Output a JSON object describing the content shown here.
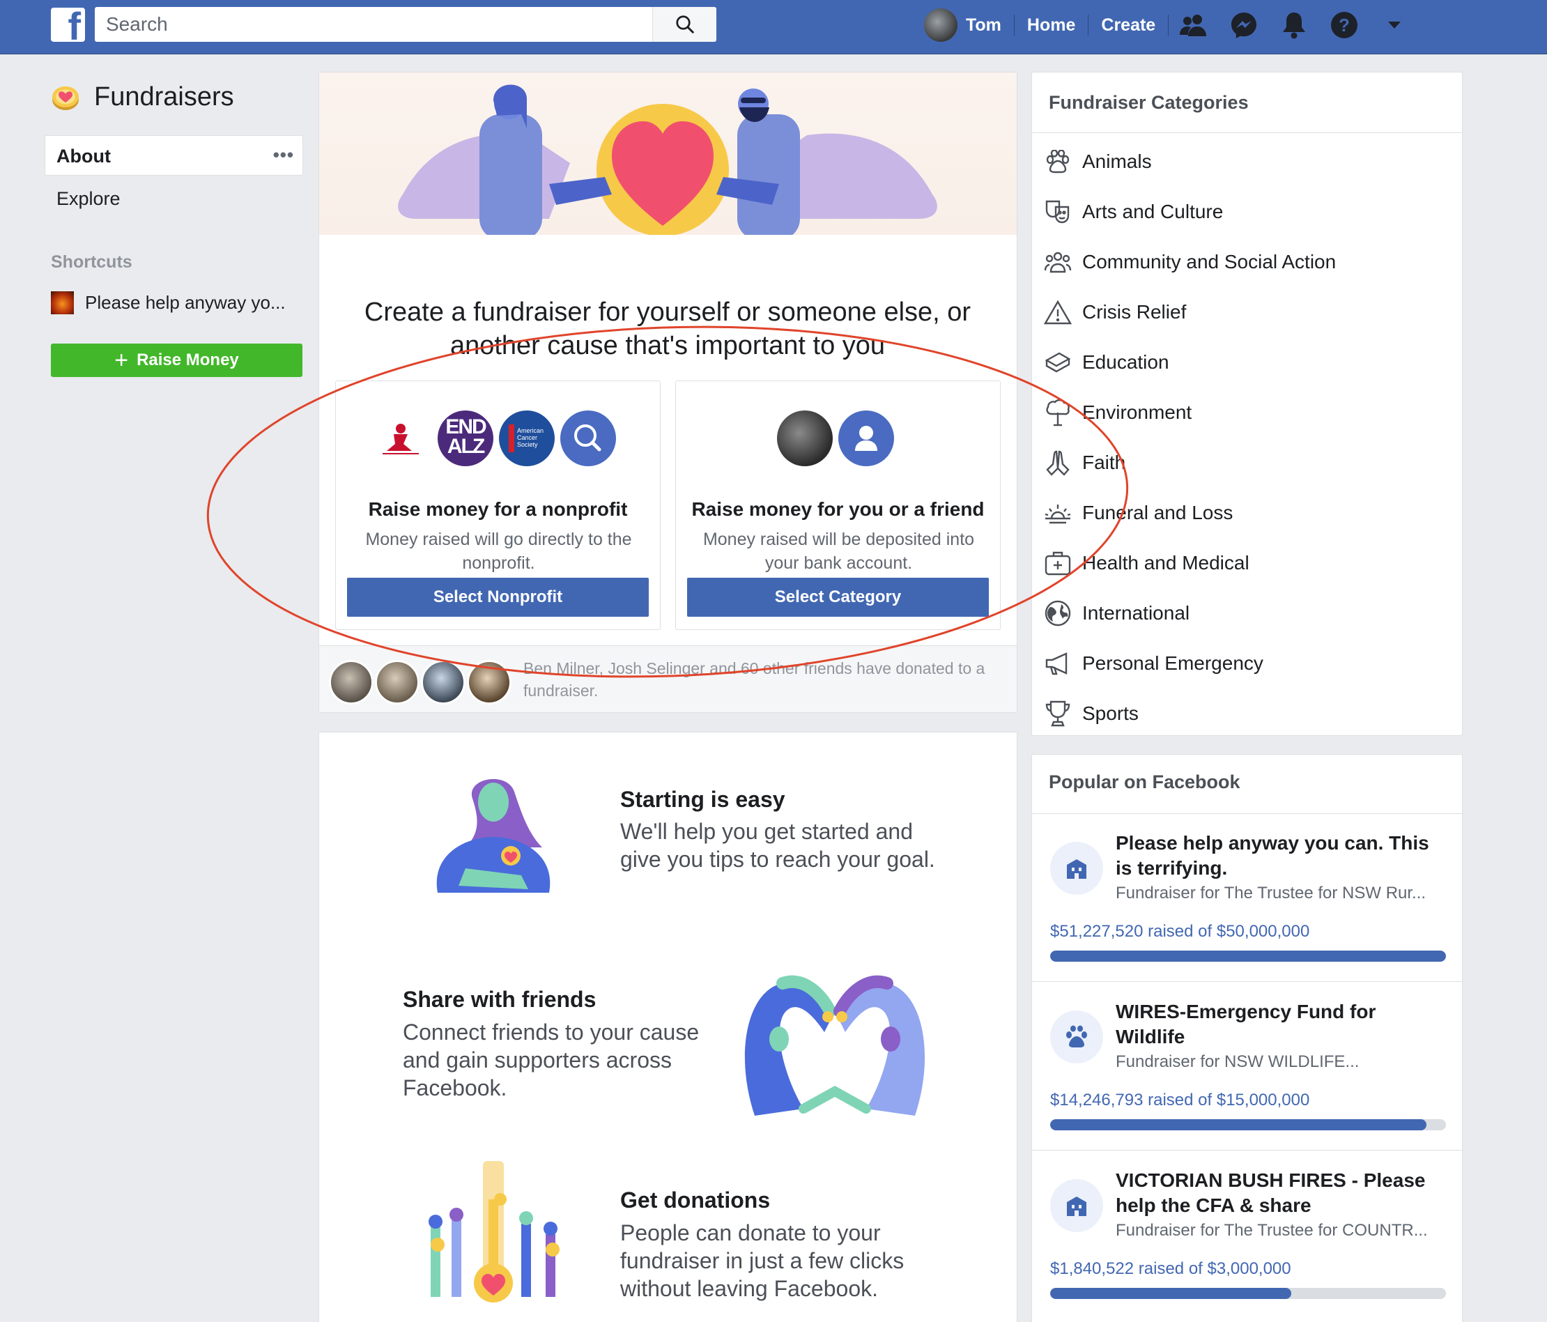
{
  "topbar": {
    "search_placeholder": "Search",
    "user_name": "Tom",
    "home_label": "Home",
    "create_label": "Create"
  },
  "left": {
    "title": "Fundraisers",
    "about_label": "About",
    "more_label": "•••",
    "explore_label": "Explore",
    "shortcuts_heading": "Shortcuts",
    "shortcut_item": "Please help anyway yo...",
    "raise_button": "Raise Money",
    "raise_icon": "+"
  },
  "hero": {
    "title": "Create a fundraiser for yourself or someone else, or another cause that's important to you",
    "nonprofit": {
      "title": "Raise money for a nonprofit",
      "desc": "Money raised will go directly to the nonprofit.",
      "button": "Select Nonprofit",
      "logo_endalz": [
        "END",
        "ALZ"
      ],
      "logo_acs": [
        "American",
        "Cancer",
        "Society"
      ]
    },
    "friend": {
      "title": "Raise money for you or a friend",
      "desc": "Money raised will be deposited into your bank account.",
      "button": "Select Category"
    },
    "footer_text": "Ben Milner, Josh Selinger and 60 other friends have donated to a fundraiser."
  },
  "steps": [
    {
      "title": "Starting is easy",
      "desc": "We'll help you get started and give you tips to reach your goal."
    },
    {
      "title": "Share with friends",
      "desc": "Connect friends to your cause and gain supporters across Facebook."
    },
    {
      "title": "Get donations",
      "desc": "People can donate to your fundraiser in just a few clicks without leaving Facebook."
    }
  ],
  "categories": {
    "heading": "Fundraiser Categories",
    "items": [
      {
        "label": "Animals",
        "icon": "paw-icon"
      },
      {
        "label": "Arts and Culture",
        "icon": "masks-icon"
      },
      {
        "label": "Community and Social Action",
        "icon": "people-icon"
      },
      {
        "label": "Crisis Relief",
        "icon": "warning-icon"
      },
      {
        "label": "Education",
        "icon": "books-icon"
      },
      {
        "label": "Environment",
        "icon": "tree-icon"
      },
      {
        "label": "Faith",
        "icon": "praying-hands-icon"
      },
      {
        "label": "Funeral and Loss",
        "icon": "sunset-icon"
      },
      {
        "label": "Health and Medical",
        "icon": "medical-kit-icon"
      },
      {
        "label": "International",
        "icon": "globe-icon"
      },
      {
        "label": "Personal Emergency",
        "icon": "megaphone-icon"
      },
      {
        "label": "Sports",
        "icon": "trophy-icon"
      }
    ]
  },
  "popular": {
    "heading": "Popular on Facebook",
    "items": [
      {
        "title": "Please help anyway you can. This is terrifying.",
        "sub": "Fundraiser for The Trustee for NSW Rur...",
        "raised": "$51,227,520 raised of $50,000,000",
        "progress": 1.0,
        "icon": "building-icon"
      },
      {
        "title": "WIRES-Emergency Fund for Wildlife",
        "sub": "Fundraiser for NSW WILDLIFE...",
        "raised": "$14,246,793 raised of $15,000,000",
        "progress": 0.95,
        "icon": "paw-icon"
      },
      {
        "title": "VICTORIAN BUSH FIRES - Please help the CFA & share",
        "sub": "Fundraiser for The Trustee for COUNTR...",
        "raised": "$1,840,522 raised of $3,000,000",
        "progress": 0.61,
        "icon": "building-icon"
      }
    ]
  },
  "colors": {
    "brand": "#4267b2",
    "green": "#42b72a",
    "annotation": "#e0442b"
  }
}
